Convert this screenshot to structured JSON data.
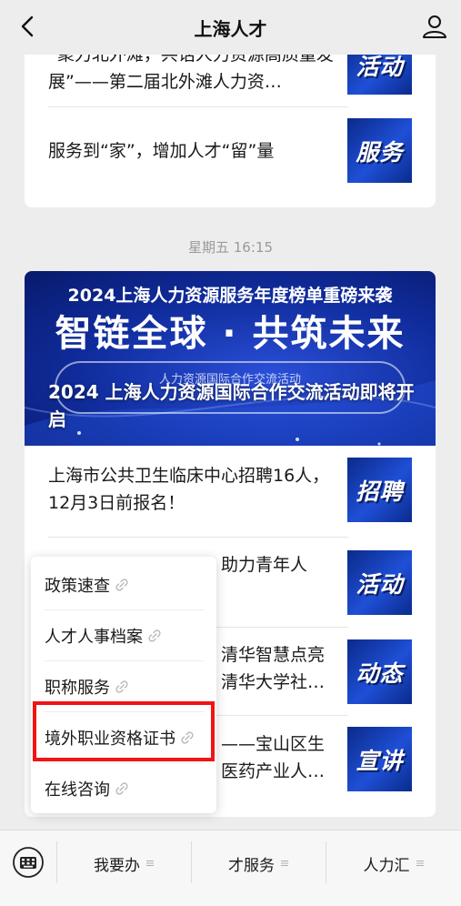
{
  "header": {
    "title": "上海人才",
    "back_icon": "chevron-left-icon",
    "profile_icon": "user-icon"
  },
  "feed": {
    "top_card": {
      "articles": [
        {
          "title": "“聚力北外滩，共话人力资源高质量发展”——第二届北外滩人力资…",
          "thumb_label": "活动"
        },
        {
          "title": "服务到“家”，增加人才“留”量",
          "thumb_label": "服务"
        }
      ]
    },
    "timestamp": "星期五 16:15",
    "main_card": {
      "banner": {
        "subtitle": "2024上海人力资源服务年度榜单重磅来袭",
        "headline": "智链全球 · 共筑未来",
        "pill_text": "人力资源国际合作交流活动",
        "title": "2024 上海人力资源国际合作交流活动即将开启"
      },
      "articles": [
        {
          "title": "上海市公共卫生临床中心招聘16人，12月3日前报名！",
          "thumb_label": "招聘"
        },
        {
          "title": "助力青年人",
          "thumb_label": "活动"
        },
        {
          "title": "清华智慧点亮 清华大学社…",
          "thumb_label": "动态"
        },
        {
          "title": "——宝山区生 医药产业人…",
          "thumb_label": "宣讲"
        }
      ]
    }
  },
  "popup_menu": {
    "items": [
      {
        "label": "政策速查"
      },
      {
        "label": "人才人事档案"
      },
      {
        "label": "职称服务"
      },
      {
        "label": "境外职业资格证书"
      },
      {
        "label": "在线咨询"
      }
    ],
    "link_icon": "link-icon",
    "highlighted_item": "境外职业资格证书",
    "highlight_color": "#f01414"
  },
  "bottom_bar": {
    "keyboard_icon": "keyboard-icon",
    "tabs": [
      {
        "label": "我要办"
      },
      {
        "label": "才服务"
      },
      {
        "label": "人力汇"
      }
    ]
  },
  "colors": {
    "background": "#ededed",
    "thumb_blue": "#1f4fd6",
    "banner_blue": "#102c9c"
  }
}
